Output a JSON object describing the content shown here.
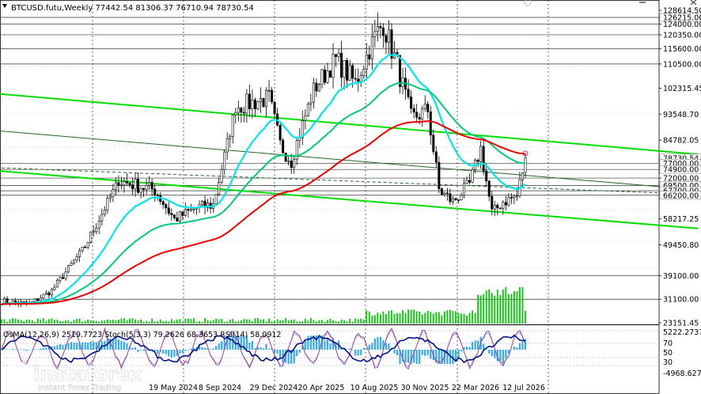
{
  "window": {
    "symbol_line": "BTCUSD.futu,Weekly  77442.54 81306.37 76710.94 78730.54",
    "controls": [
      "minimize",
      "close"
    ]
  },
  "colors": {
    "background": "#ffffff",
    "candle": "#000000",
    "ma_fast": "#00e5ee",
    "ma_mid": "#00cc77",
    "ma_slow": "#ee0000",
    "channel": "#00dd00",
    "volume": "#00cc00",
    "level_line": "#333333",
    "grid": "#000000"
  },
  "price_axis": {
    "labels": [
      "128614.50",
      "124000.00",
      "120350.00",
      "115600.00",
      "110500.00",
      "102315.45",
      "93548.70",
      "84782.05",
      "72000.00",
      "58217.25",
      "49450.80",
      "39100.00",
      "31100.00",
      "23151.45"
    ],
    "tags": [
      "126215.00",
      "78730.54",
      "77000.00",
      "74900.00",
      "69500.00",
      "67700.00",
      "66200.00"
    ]
  },
  "time_axis": {
    "labels": [
      "19 May 2024",
      "8 Sep 2024",
      "29 Dec 2024",
      "20 Apr 2025",
      "10 Aug 2025",
      "30 Nov 2025",
      "22 Mar 2026",
      "12 Jul 2026"
    ]
  },
  "oscillator": {
    "header": "OsMA(12,26,9) 2519.7723 Stoch(5,3,3) 79.2626 68.3653 RSI(14) 58.0912",
    "scale": [
      "5222.2737",
      "70",
      "50",
      "30",
      "-4968.6279"
    ]
  },
  "watermark": {
    "brand": "instaforex",
    "tagline": "Instant Forex Trading"
  },
  "chart_data": {
    "type": "candlestick",
    "title": "BTCUSD.futu,Weekly",
    "last_bar": {
      "open": 77442.54,
      "high": 81306.37,
      "low": 76710.94,
      "close": 78730.54
    },
    "y_range": [
      23151.45,
      128614.5
    ],
    "levels": [
      126215.0,
      124000.0,
      120350.0,
      115600.0,
      110500.0,
      77000.0,
      74900.0,
      72000.0,
      69500.0,
      67700.0,
      66200.0,
      39100.0,
      31100.0
    ],
    "anchors": [
      {
        "bar": 0,
        "price": 30500
      },
      {
        "bar": 10,
        "price": 29500
      },
      {
        "bar": 18,
        "price": 34000
      },
      {
        "bar": 30,
        "price": 49000
      },
      {
        "bar": 42,
        "price": 71000
      },
      {
        "bar": 55,
        "price": 68000
      },
      {
        "bar": 62,
        "price": 58000
      },
      {
        "bar": 70,
        "price": 62000
      },
      {
        "bar": 76,
        "price": 63000
      },
      {
        "bar": 84,
        "price": 96000
      },
      {
        "bar": 96,
        "price": 99000
      },
      {
        "bar": 100,
        "price": 83000
      },
      {
        "bar": 104,
        "price": 78000
      },
      {
        "bar": 112,
        "price": 102000
      },
      {
        "bar": 120,
        "price": 112000
      },
      {
        "bar": 127,
        "price": 104000
      },
      {
        "bar": 134,
        "price": 120000
      },
      {
        "bar": 137,
        "price": 124000
      },
      {
        "bar": 142,
        "price": 110000
      },
      {
        "bar": 147,
        "price": 92000
      },
      {
        "bar": 153,
        "price": 95000
      },
      {
        "bar": 157,
        "price": 68000
      },
      {
        "bar": 162,
        "price": 64000
      },
      {
        "bar": 168,
        "price": 70000
      },
      {
        "bar": 172,
        "price": 82000
      },
      {
        "bar": 176,
        "price": 60000
      },
      {
        "bar": 180,
        "price": 64000
      },
      {
        "bar": 185,
        "price": 66000
      },
      {
        "bar": 188,
        "price": 78730
      }
    ],
    "series": [
      {
        "name": "MA fast",
        "color_key": "ma_fast"
      },
      {
        "name": "MA mid",
        "color_key": "ma_mid"
      },
      {
        "name": "MA slow",
        "color_key": "ma_slow"
      }
    ]
  }
}
